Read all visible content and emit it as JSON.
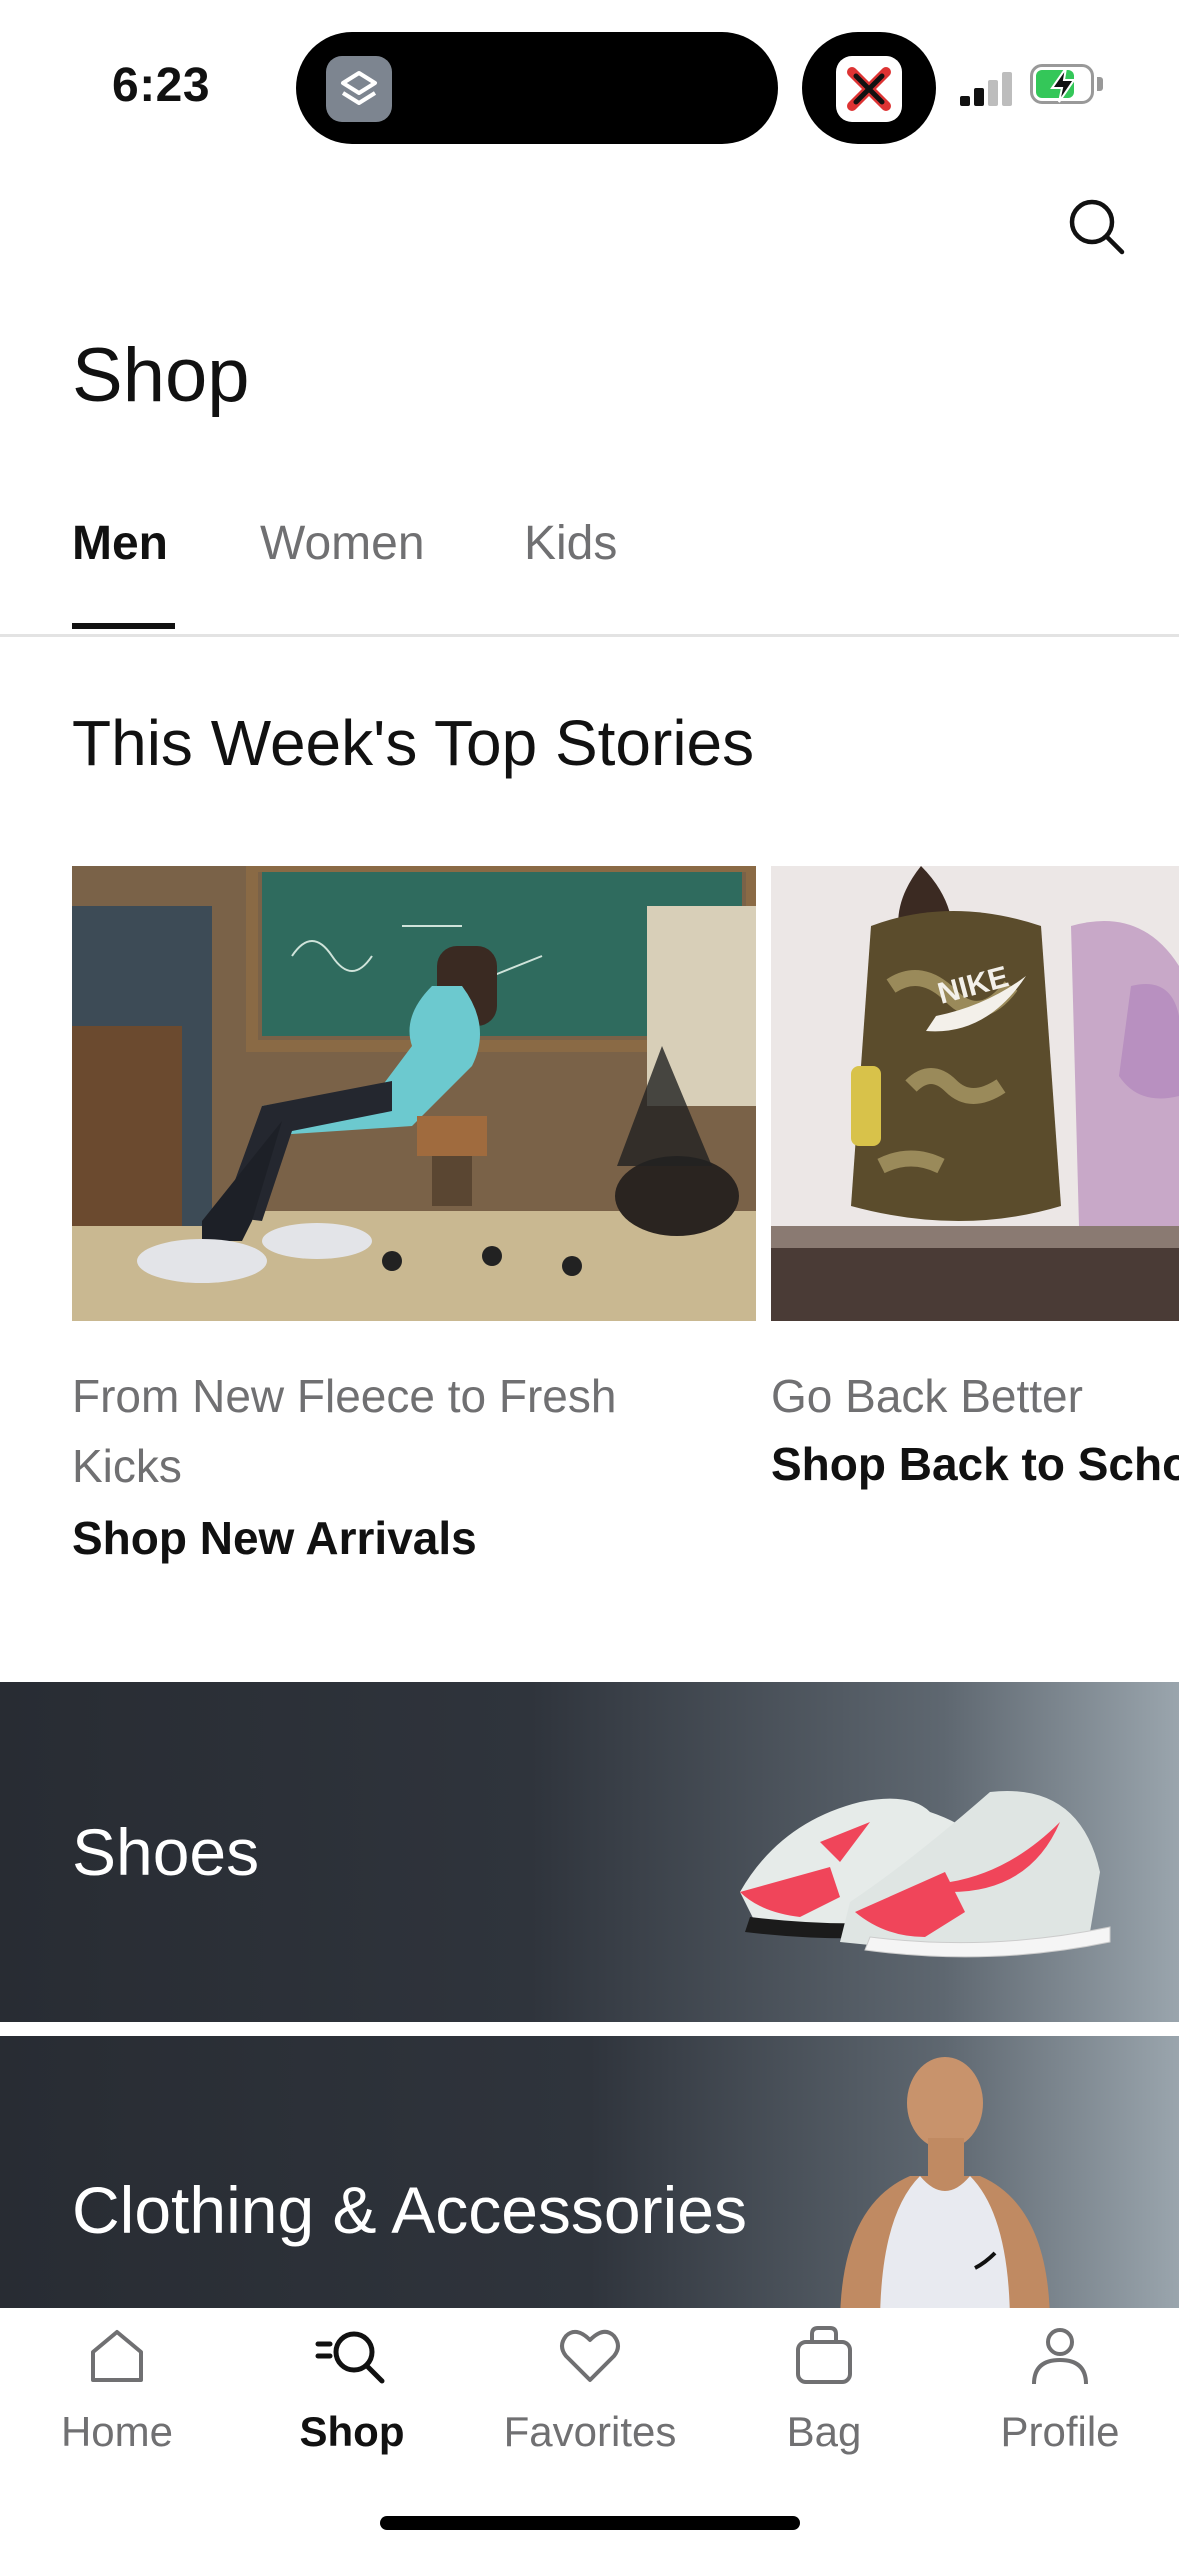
{
  "status_bar": {
    "time": "6:23"
  },
  "header": {
    "title": "Shop"
  },
  "tabs": [
    {
      "label": "Men",
      "active": true
    },
    {
      "label": "Women",
      "active": false
    },
    {
      "label": "Kids",
      "active": false
    }
  ],
  "top_stories": {
    "title": "This Week's Top Stories",
    "cards": [
      {
        "subtitle": "From New Fleece to Fresh Kicks",
        "link": "Shop New Arrivals"
      },
      {
        "subtitle": "Go Back Better",
        "link": "Shop Back to School"
      }
    ]
  },
  "categories": [
    {
      "label": "Shoes"
    },
    {
      "label": "Clothing & Accessories"
    }
  ],
  "bottom_nav": [
    {
      "label": "Home",
      "icon": "home-icon"
    },
    {
      "label": "Shop",
      "icon": "shop-search-icon",
      "active": true
    },
    {
      "label": "Favorites",
      "icon": "heart-icon"
    },
    {
      "label": "Bag",
      "icon": "bag-icon"
    },
    {
      "label": "Profile",
      "icon": "profile-icon"
    }
  ],
  "colors": {
    "accent": "#111111",
    "muted": "#707072",
    "battery": "#34c759",
    "shoe_red": "#f0455a"
  }
}
